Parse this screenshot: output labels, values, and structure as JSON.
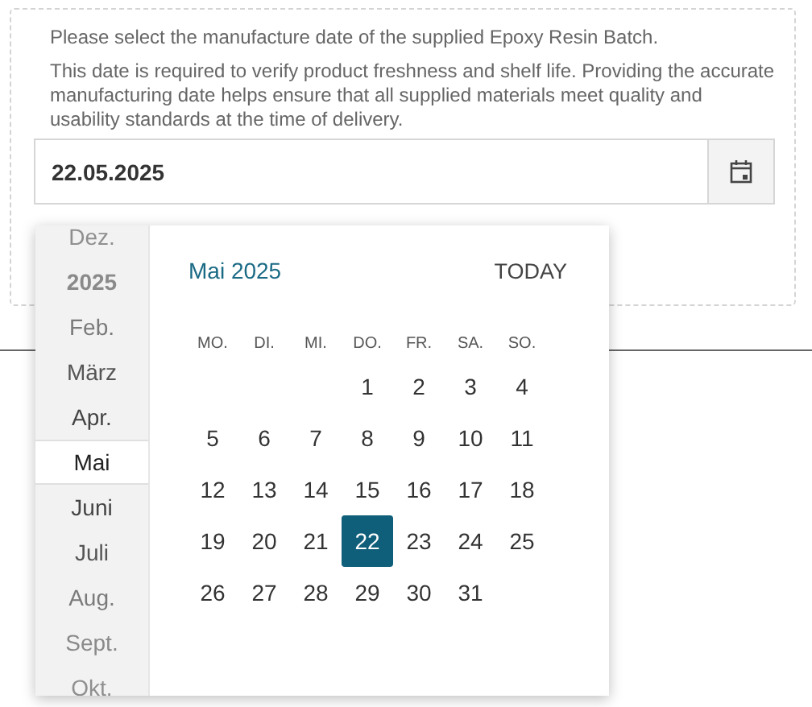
{
  "instructions": [
    "Please select the manufacture date of the supplied Epoxy Resin Batch.",
    "This date is required to verify product freshness and shelf life. Providing the accurate manufacturing date helps ensure that all supplied materials meet quality and usability standards at the time of delivery."
  ],
  "date_field": {
    "value": "22.05.2025"
  },
  "picker": {
    "month_list": [
      {
        "label": "Dez.",
        "kind": "month",
        "selected": false
      },
      {
        "label": "2025",
        "kind": "year",
        "selected": false
      },
      {
        "label": "Feb.",
        "kind": "month",
        "selected": false
      },
      {
        "label": "März",
        "kind": "month",
        "selected": false
      },
      {
        "label": "Apr.",
        "kind": "month",
        "selected": false
      },
      {
        "label": "Mai",
        "kind": "month",
        "selected": true
      },
      {
        "label": "Juni",
        "kind": "month",
        "selected": false
      },
      {
        "label": "Juli",
        "kind": "month",
        "selected": false
      },
      {
        "label": "Aug.",
        "kind": "month",
        "selected": false
      },
      {
        "label": "Sept.",
        "kind": "month",
        "selected": false
      },
      {
        "label": "Okt.",
        "kind": "month",
        "selected": false
      }
    ],
    "title": "Mai 2025",
    "today_button": "TODAY",
    "weekdays": [
      "MO.",
      "DI.",
      "MI.",
      "DO.",
      "FR.",
      "SA.",
      "SO."
    ],
    "weeks": [
      [
        {
          "day": "1",
          "selected": false
        },
        {
          "day": "2",
          "selected": false
        },
        {
          "day": "3",
          "selected": false
        },
        {
          "day": "4",
          "selected": false
        }
      ],
      [
        {
          "day": "5",
          "selected": false
        },
        {
          "day": "6",
          "selected": false
        },
        {
          "day": "7",
          "selected": false
        },
        {
          "day": "8",
          "selected": false
        },
        {
          "day": "9",
          "selected": false
        },
        {
          "day": "10",
          "selected": false
        },
        {
          "day": "11",
          "selected": false
        }
      ],
      [
        {
          "day": "12",
          "selected": false
        },
        {
          "day": "13",
          "selected": false
        },
        {
          "day": "14",
          "selected": false
        },
        {
          "day": "15",
          "selected": false
        },
        {
          "day": "16",
          "selected": false
        },
        {
          "day": "17",
          "selected": false
        },
        {
          "day": "18",
          "selected": false
        }
      ],
      [
        {
          "day": "19",
          "selected": false
        },
        {
          "day": "20",
          "selected": false
        },
        {
          "day": "21",
          "selected": false
        },
        {
          "day": "22",
          "selected": true
        },
        {
          "day": "23",
          "selected": false
        },
        {
          "day": "24",
          "selected": false
        },
        {
          "day": "25",
          "selected": false
        }
      ],
      [
        {
          "day": "26",
          "selected": false
        },
        {
          "day": "27",
          "selected": false
        },
        {
          "day": "28",
          "selected": false
        },
        {
          "day": "29",
          "selected": false
        },
        {
          "day": "30",
          "selected": false
        },
        {
          "day": "31",
          "selected": false
        }
      ]
    ]
  }
}
